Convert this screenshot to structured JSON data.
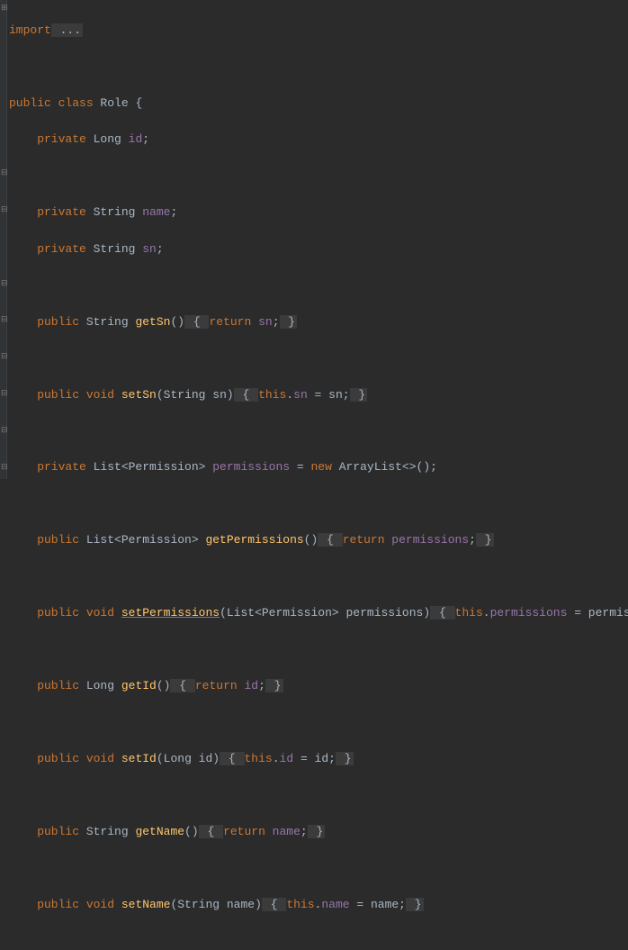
{
  "import_line": {
    "kw": "import",
    "rest": " ..."
  },
  "class_decl": {
    "mod": "public class ",
    "name": "Role",
    "brace": " {"
  },
  "field_id": {
    "mod": "    private ",
    "type": "Long ",
    "name": "id",
    "semi": ";"
  },
  "field_name": {
    "mod": "    private ",
    "type": "String ",
    "name": "name",
    "semi": ";"
  },
  "field_sn": {
    "mod": "    private ",
    "type": "String ",
    "name": "sn",
    "semi": ";"
  },
  "m_getSn": {
    "mod": "    public ",
    "ret": "String ",
    "name": "getSn",
    "params": "()",
    "open": " { ",
    "kw": "return ",
    "expr": "sn",
    "semi": ";",
    "close": " }"
  },
  "m_setSn": {
    "mod": "    public ",
    "ret": "void ",
    "name": "setSn",
    "params_open": "(String ",
    "param": "sn",
    "params_close": ")",
    "open": " { ",
    "this": "this",
    "dot": ".",
    "field": "sn",
    "eq": " = sn",
    "semi": ";",
    "close": " }"
  },
  "field_perm": {
    "mod": "    private ",
    "type1": "List<Permission> ",
    "name": "permissions",
    "eq": " = ",
    "new": "new ",
    "type2": "ArrayList<>()",
    "semi": ";"
  },
  "m_getPerm": {
    "mod": "    public ",
    "ret": "List<Permission> ",
    "name": "getPermissions",
    "params": "()",
    "open": " { ",
    "kw": "return ",
    "expr": "permissions",
    "semi": ";",
    "close": " }"
  },
  "m_setPerm": {
    "mod": "    public ",
    "ret": "void ",
    "name": "setPermissions",
    "params_open": "(List<Permission> ",
    "param": "permissions",
    "params_close": ")",
    "open": " { ",
    "this": "this",
    "dot": ".",
    "field": "permissions",
    "eq": " = permissions",
    "semi": ";",
    "close": " }"
  },
  "m_getId": {
    "mod": "    public ",
    "ret": "Long ",
    "name": "getId",
    "params": "()",
    "open": " { ",
    "kw": "return ",
    "expr": "id",
    "semi": ";",
    "close": " }"
  },
  "m_setId": {
    "mod": "    public ",
    "ret": "void ",
    "name": "setId",
    "params_open": "(Long ",
    "param": "id",
    "params_close": ")",
    "open": " { ",
    "this": "this",
    "dot": ".",
    "field": "id",
    "eq": " = id",
    "semi": ";",
    "close": " }"
  },
  "m_getName": {
    "mod": "    public ",
    "ret": "String ",
    "name": "getName",
    "params": "()",
    "open": " { ",
    "kw": "return ",
    "expr": "name",
    "semi": ";",
    "close": " }"
  },
  "m_setName": {
    "mod": "    public ",
    "ret": "void ",
    "name": "setName",
    "params_open": "(String ",
    "param": "name",
    "params_close": ")",
    "open": " { ",
    "this": "this",
    "dot": ".",
    "field": "name",
    "eq": " = name",
    "semi": ";",
    "close": " }"
  }
}
